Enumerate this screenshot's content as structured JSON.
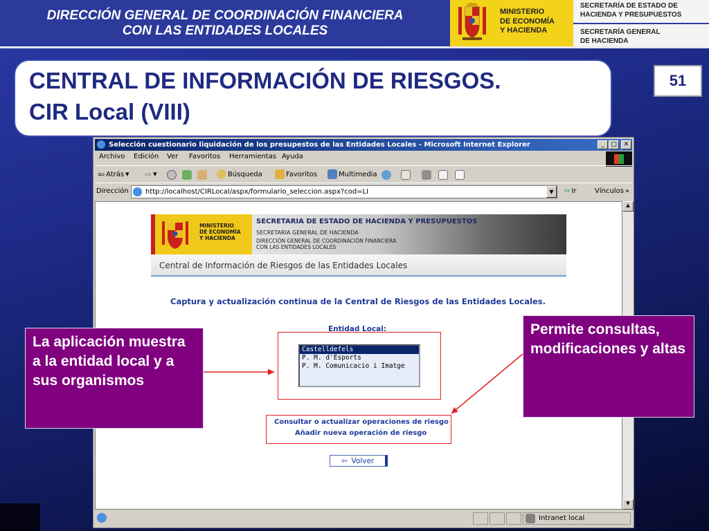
{
  "header": {
    "left_line1": "DIRECCIÓN GENERAL DE COORDINACIÓN FINANCIERA",
    "left_line2": "CON LAS ENTIDADES LOCALES",
    "ministry_line1": "MINISTERIO",
    "ministry_line2": "DE ECONOMÍA",
    "ministry_line3": "Y HACIENDA",
    "right_line1": "SECRETARÍA DE ESTADO DE",
    "right_line2": "HACIENDA Y PRESUPUESTOS",
    "right_line3": "SECRETARÍA GENERAL",
    "right_line4": "DE HACIENDA"
  },
  "title": {
    "line1": "CENTRAL DE INFORMACIÓN DE RIESGOS.",
    "line2": "CIR Local (VIII)",
    "page_number": "51"
  },
  "browser": {
    "window_title": "Selección cuestionario liquidación de los presupestos de las Entidades Locales - Microsoft Internet Explorer",
    "title_buttons": [
      "_",
      "□",
      "✕"
    ],
    "menu": [
      "Archivo",
      "Edición",
      "Ver",
      "Favoritos",
      "Herramientas",
      "Ayuda"
    ],
    "toolbar": {
      "back": "Atrás",
      "search": "Búsqueda",
      "favorites": "Favoritos",
      "multimedia": "Multimedia"
    },
    "address_label": "Dirección",
    "address_url": "http://localhost/CIRLocal/aspx/formulario_seleccion.aspx?cod=LI",
    "go_label": "Ir",
    "links_label": "Vínculos",
    "status_zone": "Intranet local"
  },
  "webpage": {
    "banner": {
      "ministry_line1": "MINISTERIO",
      "ministry_line2": "DE ECONOMÍA",
      "ministry_line3": "Y HACIENDA",
      "secretaria_estado": "SECRETARIA DE ESTADO DE HACIENDA Y PRESUPUESTOS",
      "secretaria_general": "SECRETARIA GENERAL DE HACIENDA",
      "direccion_line1": "DIRECCIÓN GENERAL DE COORDINACIÓN FINANCIERA",
      "direccion_line2": "CON LAS ENTIDADES LOCALES",
      "central_title": "Central de Información de Riesgos de las Entidades Locales"
    },
    "subtitle": "Captura y actualización continua de la Central de Riesgos de las Entidades Locales.",
    "entity_label": "Entidad Local:",
    "entities": [
      "Castelldefels",
      "P. M. d'Esports",
      "P. M. Comunicacio i Imatge"
    ],
    "selected_entity": "Castelldefels",
    "link_consult": "Consultar o actualizar operaciones de riesgo",
    "link_add": "Añadir nueva operación de riesgo",
    "back_button": "Volver"
  },
  "callouts": {
    "left": "La aplicación muestra a la entidad local y a sus organismos",
    "right": "Permite consultas, modificaciones y altas"
  },
  "colors": {
    "header_blue": "#2c3a9c",
    "ministry_yellow": "#f3d21a",
    "callout_purple": "#800080",
    "annotation_red": "#e02020",
    "link_blue": "#1e3a9a"
  }
}
